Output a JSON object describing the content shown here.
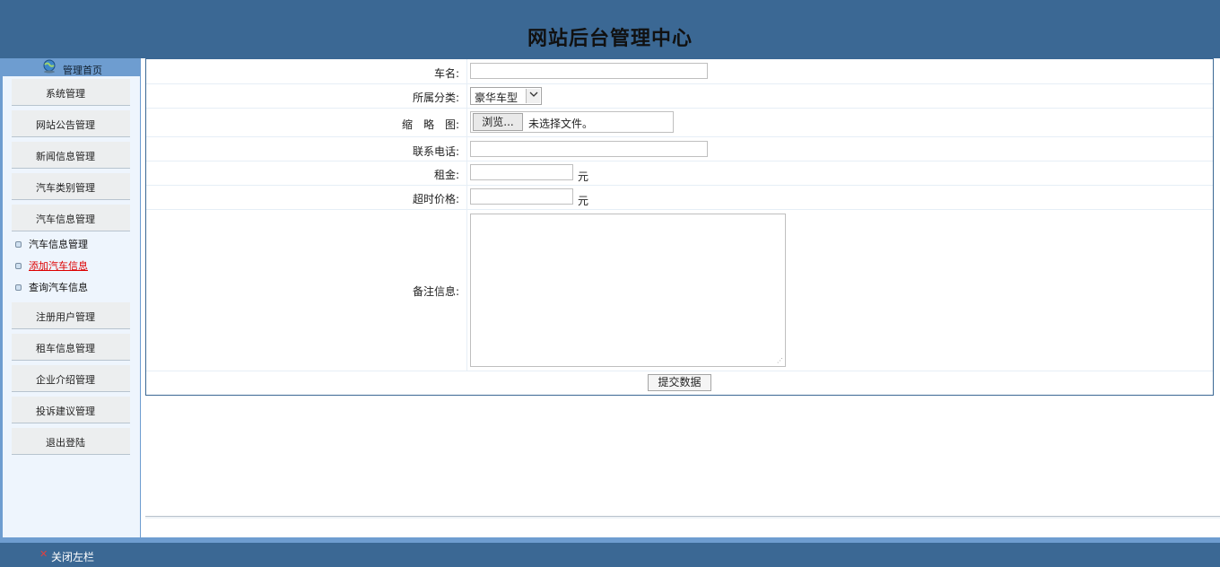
{
  "header": {
    "title": "网站后台管理中心"
  },
  "sidebar": {
    "home_label": "管理首页",
    "menu": [
      {
        "label": "系统管理"
      },
      {
        "label": "网站公告管理"
      },
      {
        "label": "新闻信息管理"
      },
      {
        "label": "汽车类别管理"
      },
      {
        "label": "汽车信息管理"
      },
      {
        "label": "注册用户管理"
      },
      {
        "label": "租车信息管理"
      },
      {
        "label": "企业介绍管理"
      },
      {
        "label": "投诉建议管理"
      },
      {
        "label": "退出登陆"
      }
    ],
    "submenu": [
      {
        "label": "汽车信息管理"
      },
      {
        "label": "添加汽车信息"
      },
      {
        "label": "查询汽车信息"
      }
    ]
  },
  "form": {
    "name_label": "车名:",
    "name_value": "",
    "category_label": "所属分类:",
    "category_value": "豪华车型",
    "thumb_label": "缩　略　图:",
    "browse_label": "浏览...",
    "file_status": "未选择文件。",
    "phone_label": "联系电话:",
    "phone_value": "",
    "rent_label": "租金:",
    "rent_value": "",
    "rent_unit": "元",
    "overtime_label": "超时价格:",
    "overtime_value": "",
    "overtime_unit": "元",
    "remark_label": "备注信息:",
    "remark_value": "",
    "submit_label": "提交数据"
  },
  "footer": {
    "close_label": "关闭左栏"
  },
  "colors": {
    "header_bg": "#3b6894",
    "sidebar_bg": "#6e9dd0",
    "active_link": "#dd0000"
  },
  "icons": [
    "globe-icon",
    "chevron-down-icon",
    "close-icon",
    "bullet-icon"
  ]
}
